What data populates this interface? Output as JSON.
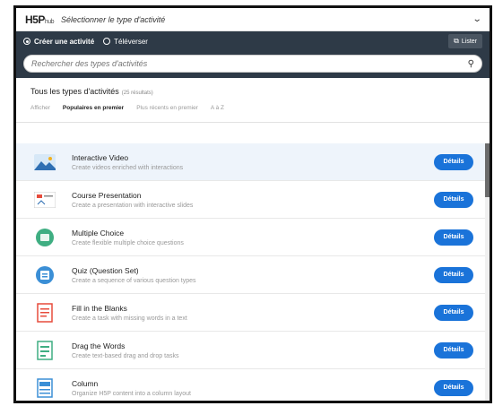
{
  "header": {
    "logo": "H5P",
    "logo_sub": "hub",
    "title": "Sélectionner le type d'activité"
  },
  "tabs": {
    "create": "Créer une activité",
    "upload": "Téléverser",
    "load_button": "Lister"
  },
  "search": {
    "placeholder": "Rechercher des types d'activités"
  },
  "filters": {
    "heading": "Tous les types d'activités",
    "count": "(25 résultats)",
    "show_label": "Afficher",
    "sort_popular": "Populaires en premier",
    "sort_recent": "Plus récents en premier",
    "sort_az": "A à Z"
  },
  "items": [
    {
      "name": "Interactive Video",
      "desc": "Create videos enriched with interactions",
      "icon": "interactive-video-icon",
      "button": "Détails"
    },
    {
      "name": "Course Presentation",
      "desc": "Create a presentation with interactive slides",
      "icon": "course-presentation-icon",
      "button": "Détails"
    },
    {
      "name": "Multiple Choice",
      "desc": "Create flexible multiple choice questions",
      "icon": "multiple-choice-icon",
      "button": "Détails"
    },
    {
      "name": "Quiz (Question Set)",
      "desc": "Create a sequence of various question types",
      "icon": "question-set-icon",
      "button": "Détails"
    },
    {
      "name": "Fill in the Blanks",
      "desc": "Create a task with missing words in a text",
      "icon": "fill-blanks-icon",
      "button": "Détails"
    },
    {
      "name": "Drag the Words",
      "desc": "Create text-based drag and drop tasks",
      "icon": "drag-words-icon",
      "button": "Détails"
    },
    {
      "name": "Column",
      "desc": "Organize H5P content into a column layout",
      "icon": "column-icon",
      "button": "Détails"
    }
  ],
  "colors": {
    "accent": "#1a73d9",
    "tabbar": "#2e3a47",
    "highlight": "#eef4fb"
  }
}
